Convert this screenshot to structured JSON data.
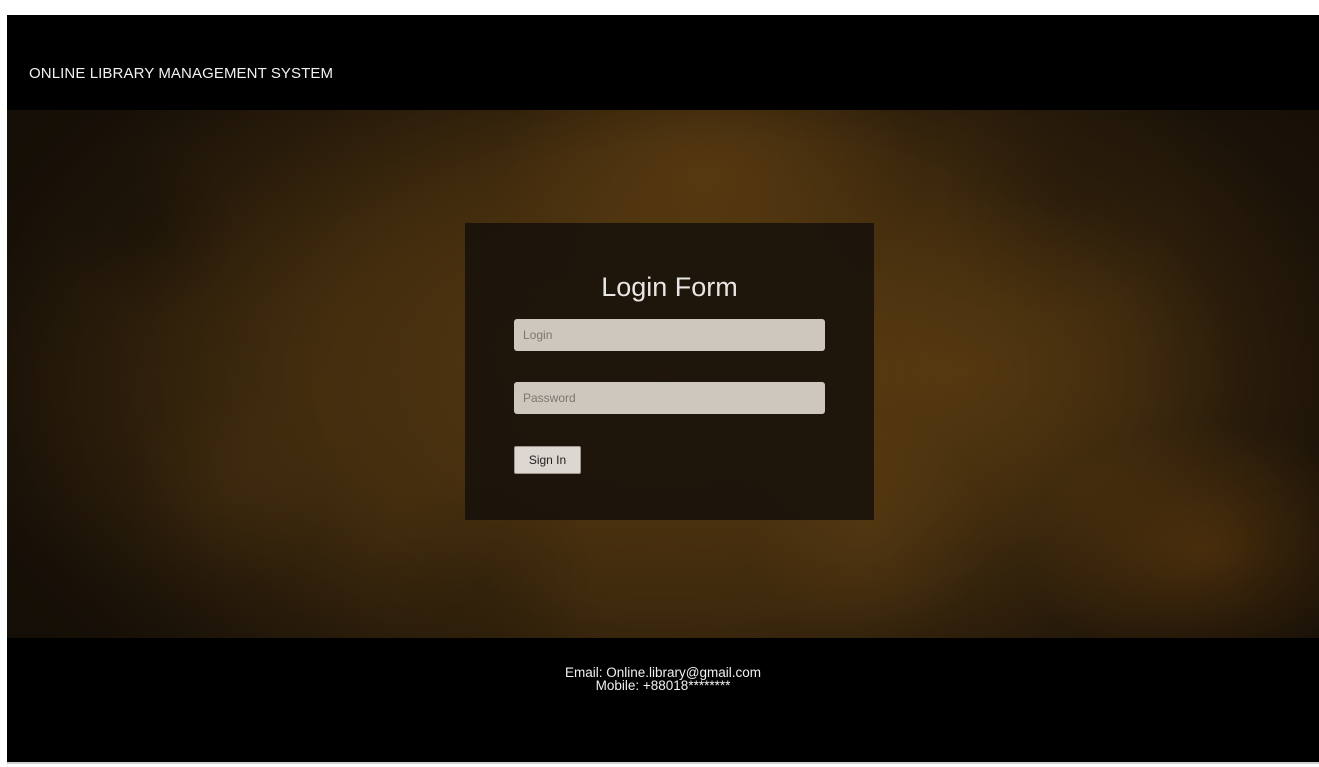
{
  "header": {
    "title": "ONLINE LIBRARY MANAGEMENT SYSTEM"
  },
  "login_form": {
    "heading": "Login Form",
    "login_placeholder": "Login",
    "password_placeholder": "Password",
    "login_value": "",
    "password_value": "",
    "signin_label": "Sign In"
  },
  "footer": {
    "email": "Email: Online.library@gmail.com",
    "mobile": "Mobile: +88018********"
  },
  "colors": {
    "header_bg": "#000000",
    "footer_bg": "#000000",
    "hero_bg": "#4a3210",
    "panel_bg": "#16100a",
    "input_bg": "#cdc7be",
    "button_bg": "#dcd7d0"
  }
}
